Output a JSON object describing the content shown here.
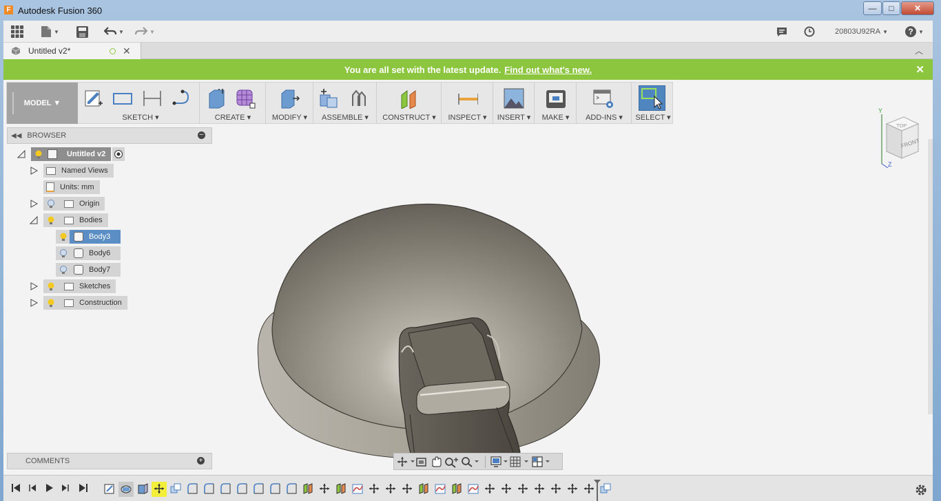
{
  "window": {
    "title": "Autodesk Fusion 360",
    "app_icon_letter": "F",
    "min": "—",
    "max": "□",
    "close": "✕"
  },
  "qat": {
    "user": "20803U92RA",
    "help": "?"
  },
  "doc_tab": {
    "title": "Untitled v2*"
  },
  "banner": {
    "text": "You are all set with the latest update.",
    "link": "Find out what's new.",
    "close": "✕"
  },
  "toolbar": {
    "workspace": "MODEL ▼",
    "groups": [
      "SKETCH ▾",
      "CREATE ▾",
      "MODIFY ▾",
      "ASSEMBLE ▾",
      "CONSTRUCT ▾",
      "INSPECT ▾",
      "INSERT ▾",
      "MAKE ▾",
      "ADD-INS ▾",
      "SELECT ▾"
    ]
  },
  "browser": {
    "title": "BROWSER",
    "root": "Untitled v2",
    "named_views": "Named Views",
    "units": "Units: mm",
    "origin": "Origin",
    "bodies": "Bodies",
    "body_items": [
      "Body3",
      "Body6",
      "Body7"
    ],
    "sketches": "Sketches",
    "construction": "Construction"
  },
  "viewcube": {
    "top": "TOP",
    "front": "FRONT",
    "axis_y": "Y",
    "axis_z": "Z"
  },
  "comments": {
    "title": "COMMENTS"
  },
  "colors": {
    "banner": "#8cc63e",
    "selection": "#5b8ec4",
    "workspace": "#a3a3a3",
    "model": "#7d776c"
  }
}
